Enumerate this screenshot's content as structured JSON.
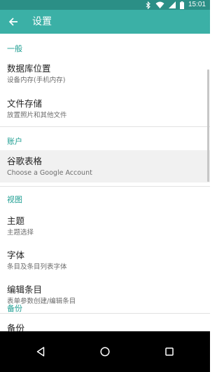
{
  "status_bar": {
    "time": "15:01"
  },
  "toolbar": {
    "title": "设置"
  },
  "sections": {
    "general": "一般",
    "account": "账户",
    "view": "视图",
    "backup": "备份"
  },
  "items": {
    "database_location": {
      "title": "数据库位置",
      "subtitle": "设备内存(手机内存)"
    },
    "file_storage": {
      "title": "文件存储",
      "subtitle": "放置照片和其他文件"
    },
    "google_sheets": {
      "title": "谷歌表格",
      "subtitle": "Choose a Google Account"
    },
    "theme": {
      "title": "主题",
      "subtitle": "主题选择"
    },
    "font": {
      "title": "字体",
      "subtitle": "条目及条目列表字体"
    },
    "edit_items": {
      "title": "编辑条目",
      "subtitle": "表单参数创建/编辑条目"
    },
    "backup": {
      "title": "备份"
    }
  },
  "icons": {
    "back": "arrow-left-icon",
    "nav_back": "triangle-back-icon",
    "nav_home": "circle-home-icon",
    "nav_recents": "square-recents-icon"
  },
  "colors": {
    "status_bar": "#2b8f86",
    "toolbar": "#3bb0a6",
    "accent": "#1e9e92",
    "selected_row": "#f1f1f1"
  }
}
